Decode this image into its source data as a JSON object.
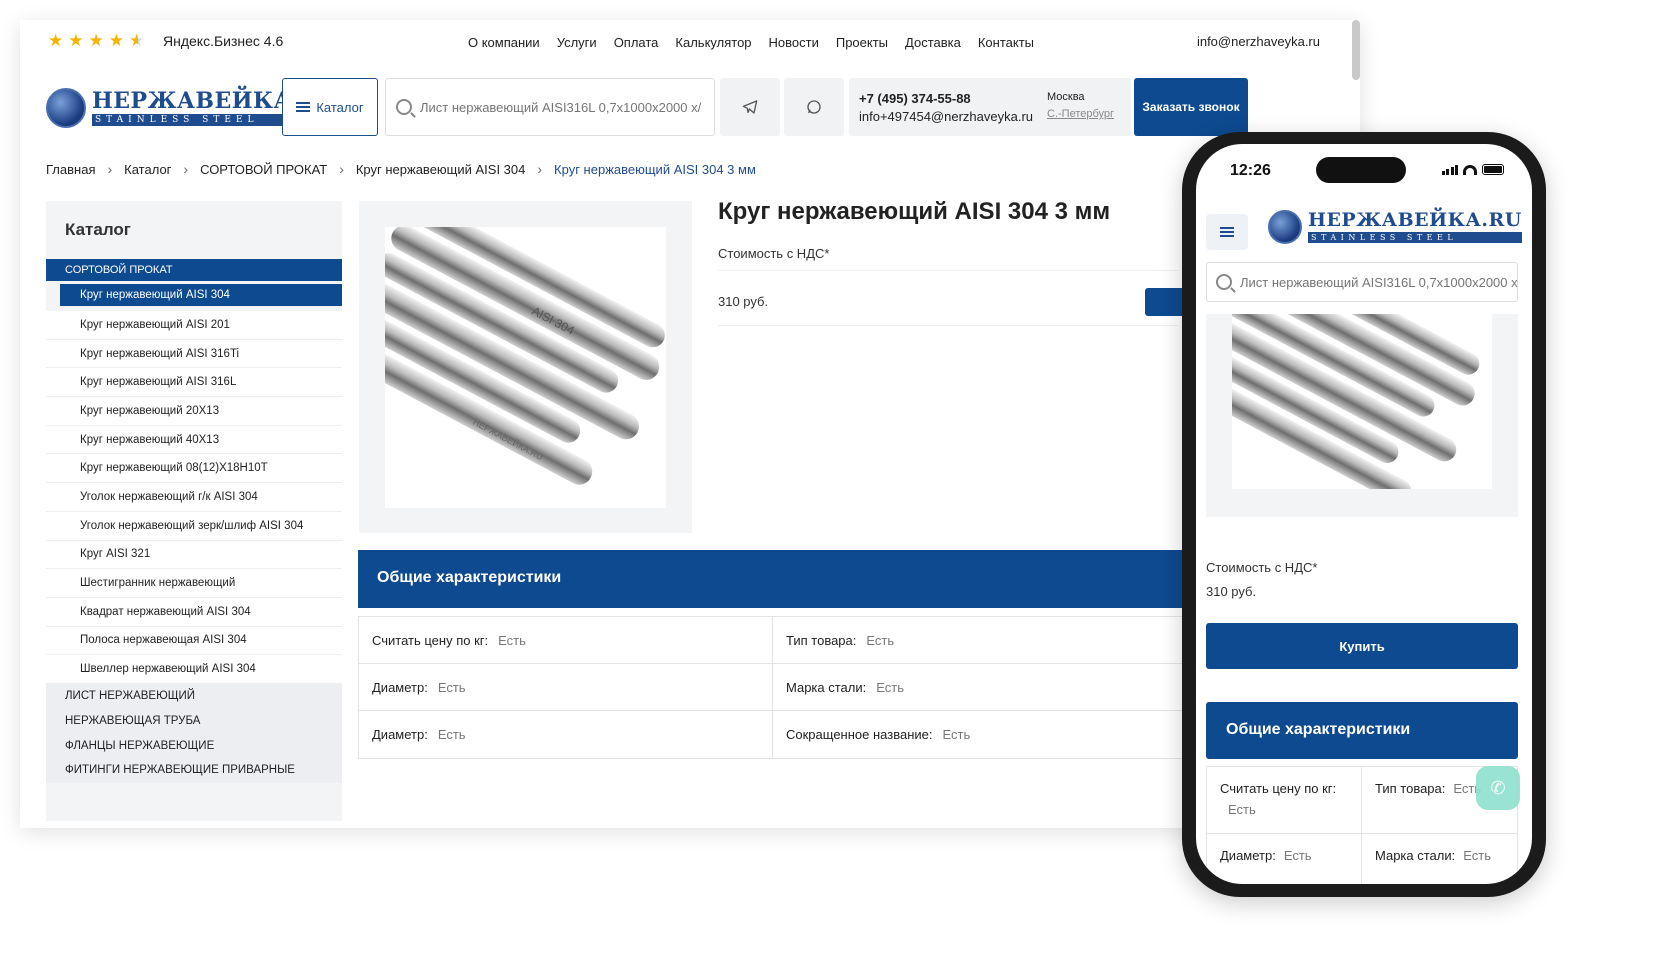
{
  "rating": {
    "stars": 4.6,
    "label": "Яндекс.Бизнес 4.6"
  },
  "topnav": [
    "О компании",
    "Услуги",
    "Оплата",
    "Калькулятор",
    "Новости",
    "Проекты",
    "Доставка",
    "Контакты"
  ],
  "top_email": "info@nerzhaveyka.ru",
  "logo": {
    "main": "НЕРЖАВЕЙКА.RU",
    "sub": "STAINLESS STEEL"
  },
  "header": {
    "catalog_label": "Каталог",
    "search_placeholder": "Лист нержавеющий AISI316L 0,7x1000x2000 x/",
    "phone": "+7 (495) 374-55-88",
    "email": "info+497454@nerzhaveyka.ru",
    "city_current": "Москва",
    "city_other": "С.-Петербург",
    "order_call": "Заказать звонок"
  },
  "breadcrumb": [
    "Главная",
    "Каталог",
    "СОРТОВОЙ ПРОКАТ",
    "Круг нержавеющий AISI 304",
    "Круг нержавеющий AISI 304 3 мм"
  ],
  "sidebar": {
    "title": "Каталог",
    "section": "СОРТОВОЙ ПРОКАТ",
    "items": [
      "Круг нержавеющий AISI 304",
      "Круг нержавеющий AISI 201",
      "Круг нержавеющий AISI 316Ti",
      "Круг нержавеющий AISI 316L",
      "Круг нержавеющий 20Х13",
      "Круг нержавеющий 40Х13",
      "Круг нержавеющий 08(12)Х18Н10Т",
      "Уголок нержавеющий г/к AISI 304",
      "Уголок нержавеющий зерк/шлиф AISI 304",
      "Круг AISI 321",
      "Шестигранник нержавеющий",
      "Квадрат нержавеющий AISI 304",
      "Полоса нержавеющая AISI 304",
      "Швеллер нержавеющий AISI 304"
    ],
    "categories": [
      "ЛИСТ НЕРЖАВЕЮЩИЙ",
      "НЕРЖАВЕЮЩАЯ ТРУБА",
      "ФЛАНЦЫ НЕРЖАВЕЮЩИЕ",
      "ФИТИНГИ НЕРЖАВЕЮЩИЕ ПРИВАРНЫЕ"
    ]
  },
  "product": {
    "title": "Круг нержавеющий AISI 304 3 мм",
    "vat_label": "Стоимость с НДС*",
    "price": "310 руб.",
    "image_stamp": "AISI 304",
    "image_brand": "НЕРЖАВЕЙКА.RU"
  },
  "characteristics": {
    "title": "Общие характеристики",
    "rows": [
      [
        {
          "label": "Считать цену по кг:",
          "value": "Есть"
        },
        {
          "label": "Тип товара:",
          "value": "Есть"
        }
      ],
      [
        {
          "label": "Диаметр:",
          "value": "Есть"
        },
        {
          "label": "Марка стали:",
          "value": "Есть"
        }
      ],
      [
        {
          "label": "Диаметр:",
          "value": "Есть"
        },
        {
          "label": "Сокращенное название:",
          "value": "Есть"
        }
      ]
    ]
  },
  "mobile": {
    "time": "12:26",
    "buy_label": "Купить",
    "rows": [
      [
        {
          "label": "Считать цену по кг:",
          "value": "Есть"
        },
        {
          "label": "Тип товара:",
          "value": "Есть"
        }
      ],
      [
        {
          "label": "Диаметр:",
          "value": "Есть"
        },
        {
          "label": "Марка стали:",
          "value": "Есть"
        }
      ]
    ]
  },
  "colors": {
    "brand": "#0e4a8f",
    "star": "#f4b400",
    "sidebar_bg": "#f3f4f6"
  }
}
